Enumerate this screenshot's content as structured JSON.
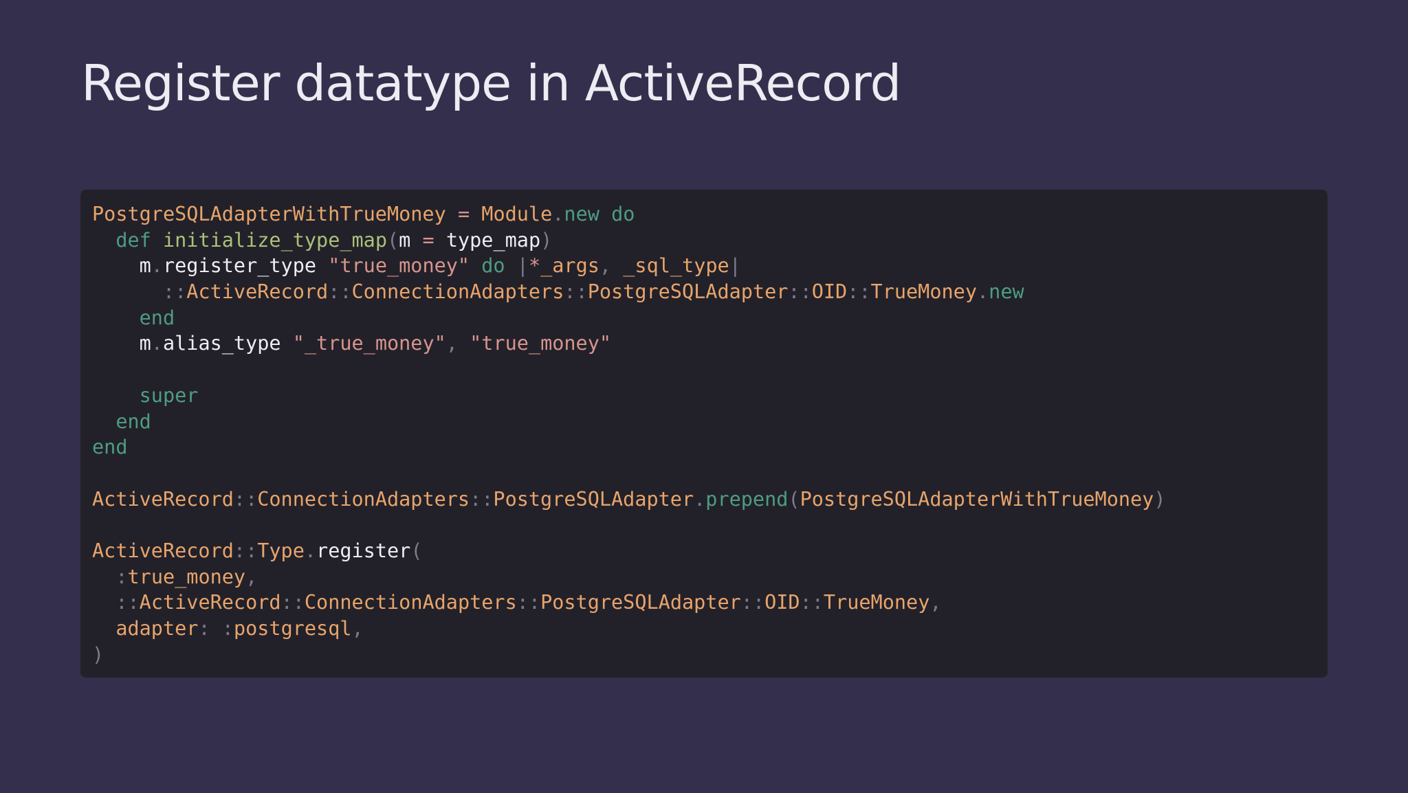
{
  "slide": {
    "title": "Register datatype in ActiveRecord",
    "background": "#332f4c"
  },
  "code": {
    "language": "ruby",
    "panel_background": "#222129",
    "colors": {
      "constant": "#e8a46c",
      "keyword": "#4e9c83",
      "method_def": "#abc17a",
      "string": "#d8948e",
      "identifier": "#ededf3",
      "punctuation": "#7c7a8c"
    },
    "lines": [
      [
        {
          "t": "const",
          "v": "PostgreSQLAdapterWithTrueMoney"
        },
        {
          "t": "id",
          "v": " "
        },
        {
          "t": "op",
          "v": "="
        },
        {
          "t": "id",
          "v": " "
        },
        {
          "t": "const",
          "v": "Module"
        },
        {
          "t": "punct",
          "v": "."
        },
        {
          "t": "kw",
          "v": "new"
        },
        {
          "t": "id",
          "v": " "
        },
        {
          "t": "kw",
          "v": "do"
        }
      ],
      [
        {
          "t": "id",
          "v": "  "
        },
        {
          "t": "kw",
          "v": "def"
        },
        {
          "t": "id",
          "v": " "
        },
        {
          "t": "meth",
          "v": "initialize_type_map"
        },
        {
          "t": "punct",
          "v": "("
        },
        {
          "t": "id",
          "v": "m "
        },
        {
          "t": "op",
          "v": "="
        },
        {
          "t": "id",
          "v": " type_map"
        },
        {
          "t": "punct",
          "v": ")"
        }
      ],
      [
        {
          "t": "id",
          "v": "    m"
        },
        {
          "t": "punct",
          "v": "."
        },
        {
          "t": "id",
          "v": "register_type "
        },
        {
          "t": "str",
          "v": "\"true_money\""
        },
        {
          "t": "id",
          "v": " "
        },
        {
          "t": "kw",
          "v": "do"
        },
        {
          "t": "id",
          "v": " "
        },
        {
          "t": "punct",
          "v": "|"
        },
        {
          "t": "op",
          "v": "*"
        },
        {
          "t": "const",
          "v": "_args"
        },
        {
          "t": "punct",
          "v": ","
        },
        {
          "t": "id",
          "v": " "
        },
        {
          "t": "const",
          "v": "_sql_type"
        },
        {
          "t": "punct",
          "v": "|"
        }
      ],
      [
        {
          "t": "id",
          "v": "      "
        },
        {
          "t": "punct",
          "v": "::"
        },
        {
          "t": "const",
          "v": "ActiveRecord"
        },
        {
          "t": "punct",
          "v": "::"
        },
        {
          "t": "const",
          "v": "ConnectionAdapters"
        },
        {
          "t": "punct",
          "v": "::"
        },
        {
          "t": "const",
          "v": "PostgreSQLAdapter"
        },
        {
          "t": "punct",
          "v": "::"
        },
        {
          "t": "const",
          "v": "OID"
        },
        {
          "t": "punct",
          "v": "::"
        },
        {
          "t": "const",
          "v": "TrueMoney"
        },
        {
          "t": "punct",
          "v": "."
        },
        {
          "t": "kw",
          "v": "new"
        }
      ],
      [
        {
          "t": "id",
          "v": "    "
        },
        {
          "t": "kw",
          "v": "end"
        }
      ],
      [
        {
          "t": "id",
          "v": "    m"
        },
        {
          "t": "punct",
          "v": "."
        },
        {
          "t": "id",
          "v": "alias_type "
        },
        {
          "t": "str",
          "v": "\"_true_money\""
        },
        {
          "t": "punct",
          "v": ","
        },
        {
          "t": "id",
          "v": " "
        },
        {
          "t": "str",
          "v": "\"true_money\""
        }
      ],
      [],
      [
        {
          "t": "id",
          "v": "    "
        },
        {
          "t": "kw",
          "v": "super"
        }
      ],
      [
        {
          "t": "id",
          "v": "  "
        },
        {
          "t": "kw",
          "v": "end"
        }
      ],
      [
        {
          "t": "kw",
          "v": "end"
        }
      ],
      [],
      [
        {
          "t": "const",
          "v": "ActiveRecord"
        },
        {
          "t": "punct",
          "v": "::"
        },
        {
          "t": "const",
          "v": "ConnectionAdapters"
        },
        {
          "t": "punct",
          "v": "::"
        },
        {
          "t": "const",
          "v": "PostgreSQLAdapter"
        },
        {
          "t": "punct",
          "v": "."
        },
        {
          "t": "kw",
          "v": "prepend"
        },
        {
          "t": "punct",
          "v": "("
        },
        {
          "t": "const",
          "v": "PostgreSQLAdapterWithTrueMoney"
        },
        {
          "t": "punct",
          "v": ")"
        }
      ],
      [],
      [
        {
          "t": "const",
          "v": "ActiveRecord"
        },
        {
          "t": "punct",
          "v": "::"
        },
        {
          "t": "const",
          "v": "Type"
        },
        {
          "t": "punct",
          "v": "."
        },
        {
          "t": "id",
          "v": "register"
        },
        {
          "t": "punct",
          "v": "("
        }
      ],
      [
        {
          "t": "id",
          "v": "  "
        },
        {
          "t": "punct",
          "v": ":"
        },
        {
          "t": "sym",
          "v": "true_money"
        },
        {
          "t": "punct",
          "v": ","
        }
      ],
      [
        {
          "t": "id",
          "v": "  "
        },
        {
          "t": "punct",
          "v": "::"
        },
        {
          "t": "const",
          "v": "ActiveRecord"
        },
        {
          "t": "punct",
          "v": "::"
        },
        {
          "t": "const",
          "v": "ConnectionAdapters"
        },
        {
          "t": "punct",
          "v": "::"
        },
        {
          "t": "const",
          "v": "PostgreSQLAdapter"
        },
        {
          "t": "punct",
          "v": "::"
        },
        {
          "t": "const",
          "v": "OID"
        },
        {
          "t": "punct",
          "v": "::"
        },
        {
          "t": "const",
          "v": "TrueMoney"
        },
        {
          "t": "punct",
          "v": ","
        }
      ],
      [
        {
          "t": "id",
          "v": "  "
        },
        {
          "t": "sym",
          "v": "adapter"
        },
        {
          "t": "punct",
          "v": ":"
        },
        {
          "t": "id",
          "v": " "
        },
        {
          "t": "punct",
          "v": ":"
        },
        {
          "t": "sym",
          "v": "postgresql"
        },
        {
          "t": "punct",
          "v": ","
        }
      ],
      [
        {
          "t": "punct",
          "v": ")"
        }
      ]
    ]
  }
}
